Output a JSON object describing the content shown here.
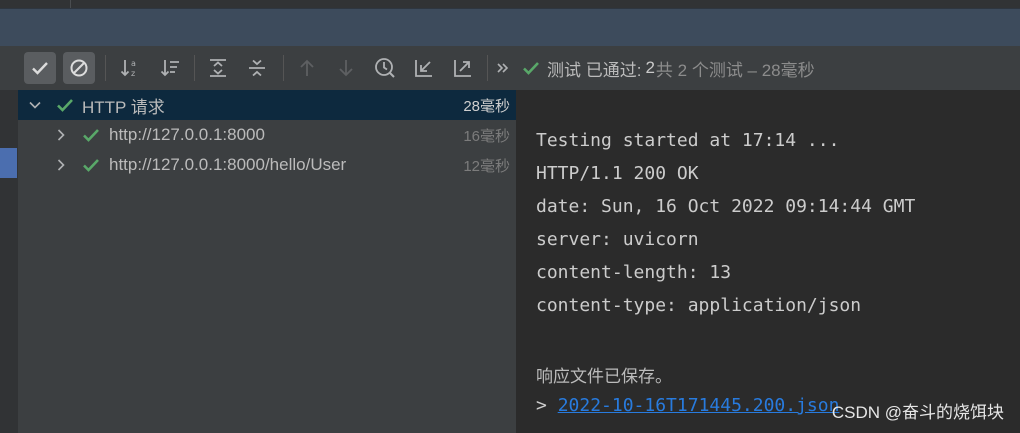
{
  "status": {
    "label": "测试 已通过:",
    "passed_count": "2",
    "summary": "共 2 个测试 – 28毫秒"
  },
  "tree": {
    "root": {
      "label": "HTTP 请求",
      "duration": "28毫秒"
    },
    "children": [
      {
        "label": "http://127.0.0.1:8000",
        "duration": "16毫秒"
      },
      {
        "label": "http://127.0.0.1:8000/hello/User",
        "duration": "12毫秒"
      }
    ]
  },
  "console": {
    "lines": [
      "Testing started at 17:14 ...",
      "HTTP/1.1 200 OK",
      "date: Sun, 16 Oct 2022 09:14:44 GMT",
      "server: uvicorn",
      "content-length: 13",
      "content-type: application/json"
    ],
    "saved_message": "响应文件已保存。",
    "prompt": ">",
    "file_link": "2022-10-16T171445.200.json"
  },
  "watermark": "CSDN @奋斗的烧饵块",
  "icons": {
    "toolbar": [
      "show-passed-icon",
      "show-ignored-icon",
      "sort-alpha-icon",
      "sort-duration-icon",
      "expand-all-icon",
      "collapse-all-icon",
      "previous-failed-icon",
      "next-failed-icon",
      "history-icon",
      "import-tests-icon",
      "export-tests-icon",
      "more-icon"
    ],
    "check": "check-icon"
  },
  "colors": {
    "pass_green": "#59a869",
    "selection": "#0d293e",
    "link": "#287bde"
  }
}
